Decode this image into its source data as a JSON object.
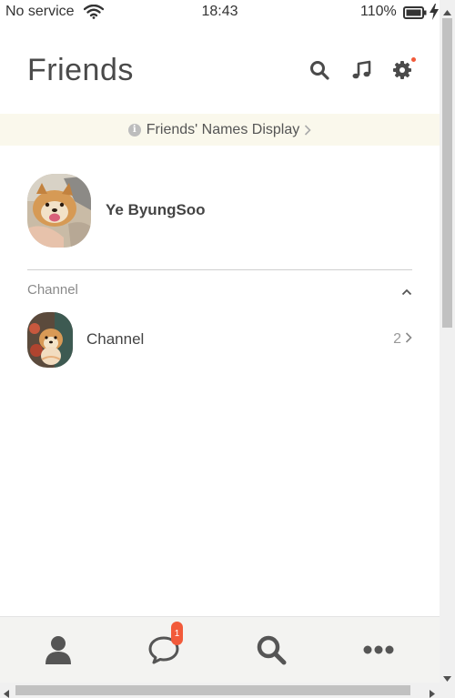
{
  "status_bar": {
    "carrier": "No service",
    "time": "18:43",
    "battery_percent": "110%"
  },
  "header": {
    "title": "Friends",
    "icons": [
      "search-icon",
      "music-icon",
      "settings-icon"
    ],
    "settings_has_notification": true
  },
  "banner": {
    "text": "Friends' Names Display"
  },
  "profile": {
    "name": "Ye ByungSoo"
  },
  "channel_section": {
    "header": "Channel",
    "collapsed": false,
    "items": [
      {
        "name": "Channel",
        "count": "2"
      }
    ]
  },
  "bottom_nav": {
    "items": [
      "friends-tab",
      "chats-tab",
      "find-tab",
      "more-tab"
    ],
    "chats_badge": "1"
  },
  "colors": {
    "banner_bg": "#faf8ec",
    "accent_red": "#f25a3a",
    "nav_bg": "#f3f3f1"
  }
}
